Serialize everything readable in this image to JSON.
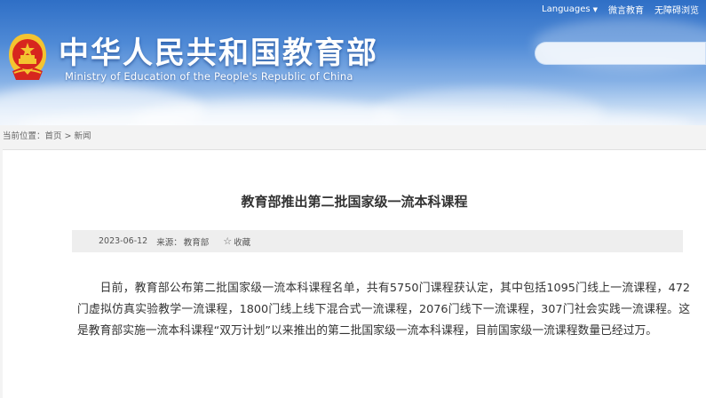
{
  "topbar": {
    "languages": "Languages",
    "weibo": "微言教育",
    "accessibility": "无障碍浏览"
  },
  "header": {
    "title": "中华人民共和国教育部",
    "subtitle": "Ministry of Education of the People's Republic of China",
    "search_placeholder": ""
  },
  "breadcrumb": {
    "label": "当前位置：",
    "home": "首页",
    "separator": " > ",
    "section": "新闻"
  },
  "article": {
    "title": "教育部推出第二批国家级一流本科课程",
    "date": "2023-06-12",
    "source_label": "来源：",
    "source": "教育部",
    "favorite": "收藏",
    "body": "日前，教育部公布第二批国家级一流本科课程名单，共有5750门课程获认定，其中包括1095门线上一流课程，472门虚拟仿真实验教学一流课程，1800门线上线下混合式一流课程，2076门线下一流课程，307门社会实践一流课程。这是教育部实施一流本科课程“双万计划”以来推出的第二批国家级一流本科课程，目前国家级一流课程数量已经过万。"
  },
  "icons": {
    "emblem": "national-emblem-icon",
    "star": "star-icon",
    "dropdown": "chevron-down-icon"
  },
  "colors": {
    "header_blue": "#2f6fc6",
    "emblem_red": "#d7261e",
    "emblem_gold": "#f4c430"
  }
}
